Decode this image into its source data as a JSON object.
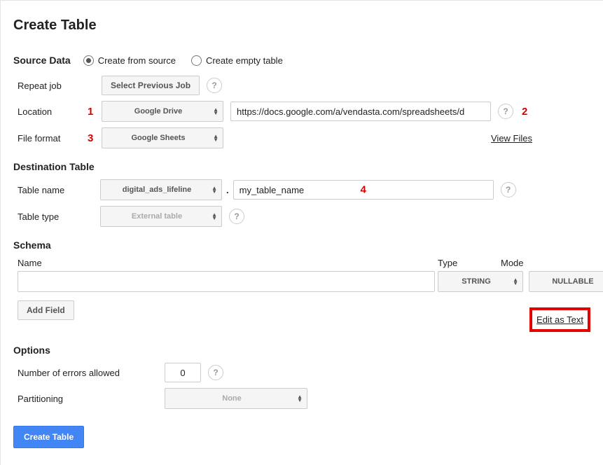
{
  "title": "Create Table",
  "source": {
    "heading": "Source Data",
    "radio_from_source": "Create from source",
    "radio_empty": "Create empty table",
    "repeat_label": "Repeat job",
    "repeat_button": "Select Previous Job",
    "location_label": "Location",
    "location_select": "Google Drive",
    "url_value": "https://docs.google.com/a/vendasta.com/spreadsheets/d",
    "format_label": "File format",
    "format_select": "Google Sheets",
    "view_files": "View Files"
  },
  "annotations": {
    "one": "1",
    "two": "2",
    "three": "3",
    "four": "4"
  },
  "dest": {
    "heading": "Destination Table",
    "name_label": "Table name",
    "dataset_select": "digital_ads_lifeline",
    "table_input": "my_table_name",
    "type_label": "Table type",
    "type_select": "External table"
  },
  "schema": {
    "heading": "Schema",
    "col_name": "Name",
    "col_type": "Type",
    "col_mode": "Mode",
    "type_select": "STRING",
    "mode_select": "NULLABLE",
    "add_field": "Add Field",
    "edit_as_text": "Edit as Text"
  },
  "options": {
    "heading": "Options",
    "errors_label": "Number of errors allowed",
    "errors_value": "0",
    "partition_label": "Partitioning",
    "partition_select": "None"
  },
  "submit": "Create Table"
}
